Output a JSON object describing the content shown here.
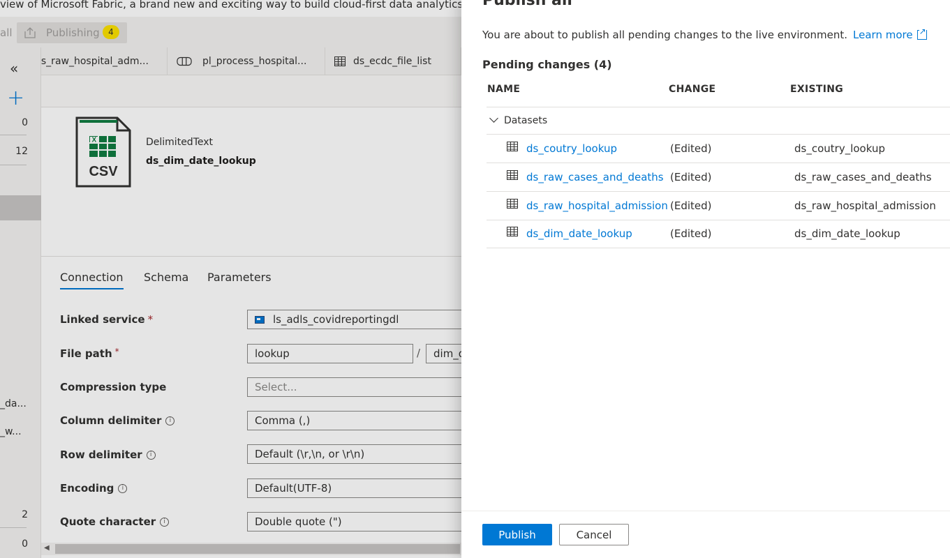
{
  "banner": {
    "text": "view of Microsoft Fabric, a brand new and exciting way to build cloud-first data analytics. Clic"
  },
  "toolbar": {
    "partial_label": "all",
    "publishing_label": "Publishing",
    "publishing_count": "4"
  },
  "left_rail": {
    "numbers": [
      "0",
      "12",
      "2",
      "0"
    ],
    "truncated_items": [
      "_da...",
      "_w..."
    ]
  },
  "tabs": [
    {
      "label": "ls_raw_hospital_adm..."
    },
    {
      "label": "pl_process_hospital..."
    },
    {
      "label": "ds_ecdc_file_list"
    }
  ],
  "dataset": {
    "type": "DelimitedText",
    "name": "ds_dim_date_lookup",
    "icon_text": "CSV"
  },
  "property_tabs": [
    "Connection",
    "Schema",
    "Parameters"
  ],
  "form": {
    "linked_service": {
      "label": "Linked service",
      "value": "ls_adls_covidreportingdl"
    },
    "file_path": {
      "label": "File path",
      "container": "lookup",
      "directory": "dim_d"
    },
    "compression_type": {
      "label": "Compression type",
      "placeholder": "Select..."
    },
    "column_delimiter": {
      "label": "Column delimiter",
      "value": "Comma (,)"
    },
    "row_delimiter": {
      "label": "Row delimiter",
      "value": "Default (\\r,\\n, or \\r\\n)"
    },
    "encoding": {
      "label": "Encoding",
      "value": "Default(UTF-8)"
    },
    "quote_character": {
      "label": "Quote character",
      "value": "Double quote (\")"
    }
  },
  "panel": {
    "title": "Publish all",
    "description": "You are about to publish all pending changes to the live environment.",
    "learn_more": "Learn more",
    "pending_title": "Pending changes (4)",
    "columns": {
      "name": "NAME",
      "change": "CHANGE",
      "existing": "EXISTING"
    },
    "group_label": "Datasets",
    "rows": [
      {
        "name": "ds_coutry_lookup",
        "change": "(Edited)",
        "existing": "ds_coutry_lookup"
      },
      {
        "name": "ds_raw_cases_and_deaths",
        "change": "(Edited)",
        "existing": "ds_raw_cases_and_deaths"
      },
      {
        "name": "ds_raw_hospital_admission",
        "change": "(Edited)",
        "existing": "ds_raw_hospital_admission"
      },
      {
        "name": "ds_dim_date_lookup",
        "change": "(Edited)",
        "existing": "ds_dim_date_lookup"
      }
    ],
    "publish_button": "Publish",
    "cancel_button": "Cancel"
  },
  "colors": {
    "accent": "#0078d4",
    "badge": "#fce100",
    "csv_green": "#107c41"
  }
}
